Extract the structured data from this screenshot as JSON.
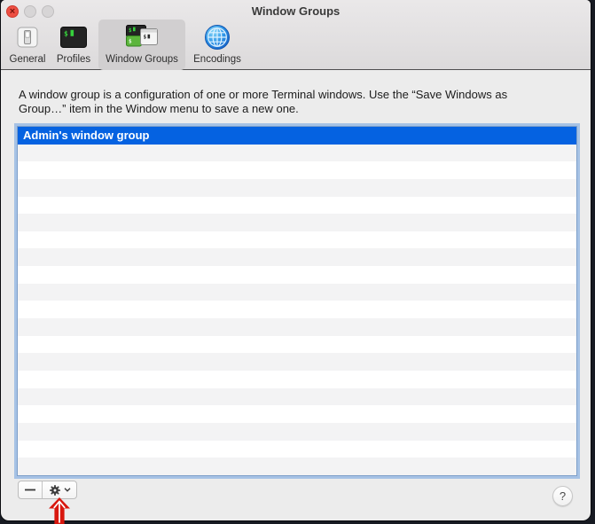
{
  "window": {
    "title": "Window Groups"
  },
  "titlebar": {
    "close_glyph": "×",
    "buttons": [
      "close",
      "minimize",
      "zoom"
    ]
  },
  "toolbar": {
    "items": [
      {
        "label": "General",
        "icon": "light-switch-icon",
        "selected": false
      },
      {
        "label": "Profiles",
        "icon": "terminal-window-icon",
        "selected": false
      },
      {
        "label": "Window Groups",
        "icon": "terminal-windows-group-icon",
        "selected": true
      },
      {
        "label": "Encodings",
        "icon": "globe-icon",
        "selected": false
      }
    ]
  },
  "description": {
    "line1": "A window group is a configuration of one or more Terminal windows. Use the “Save Windows as",
    "line2": "Group…” item in the Window menu to save a new one."
  },
  "list": {
    "items": [
      "Admin's window group"
    ],
    "selected_index": 0,
    "visible_row_count": 20,
    "selection_color": "#0562e1",
    "stripe_color": "#f3f3f4"
  },
  "footer": {
    "remove_icon": "minus-icon",
    "action_menu_icon": "gear-icon",
    "chevron_icon": "chevron-down-icon",
    "help_label": "?"
  },
  "annotation": {
    "shape": "red-arrow-up",
    "color": "#d8170e"
  }
}
